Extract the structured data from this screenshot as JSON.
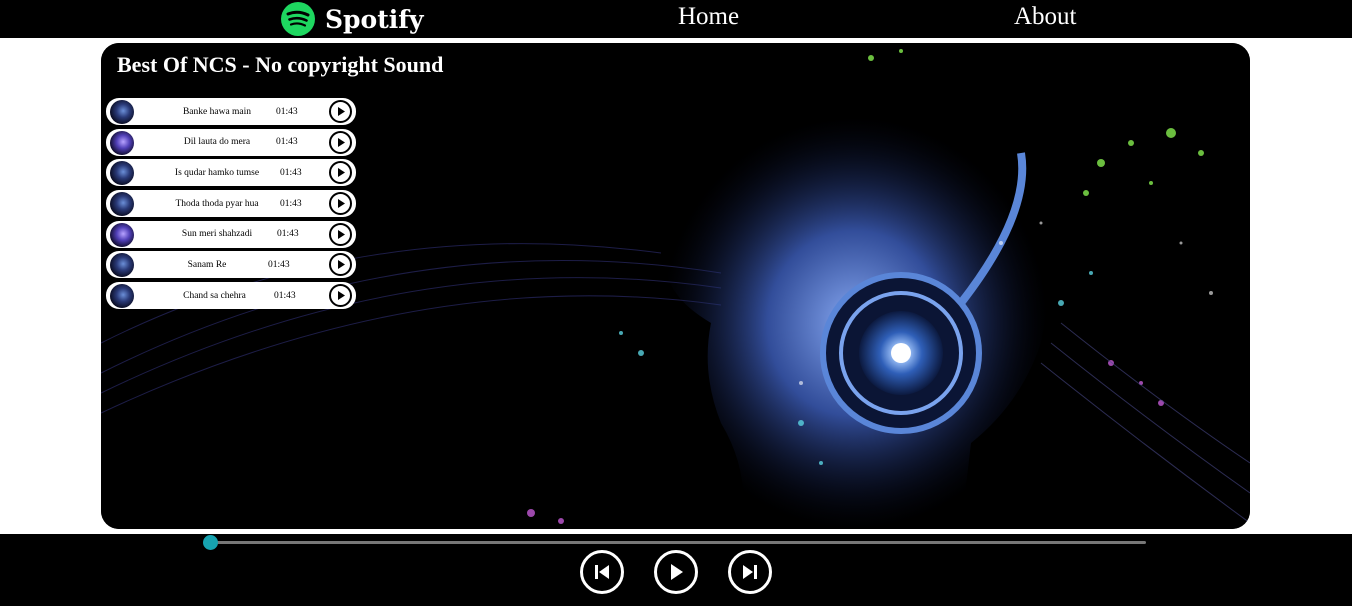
{
  "nav": {
    "brand": "Spotify",
    "links": [
      "Home",
      "About"
    ]
  },
  "playlist": {
    "title": "Best Of NCS - No copyright Sound",
    "songs": [
      {
        "name": "Banke hawa main",
        "duration": "01:43"
      },
      {
        "name": "Dil lauta do mera",
        "duration": "01:43"
      },
      {
        "name": "Is qudar hamko tumse",
        "duration": "01:43"
      },
      {
        "name": "Thoda thoda pyar hua",
        "duration": "01:43"
      },
      {
        "name": "Sun meri shahzadi",
        "duration": "01:43"
      },
      {
        "name": "Sanam Re",
        "duration": "01:43"
      },
      {
        "name": "Chand sa chehra",
        "duration": "01:43"
      }
    ]
  },
  "player": {
    "progress_fraction": 0.0,
    "controls": [
      "previous-icon",
      "play-icon",
      "next-icon"
    ]
  },
  "colors": {
    "brand_green": "#1ed760",
    "progress_thumb": "#17a3b0",
    "background": "#000000"
  }
}
